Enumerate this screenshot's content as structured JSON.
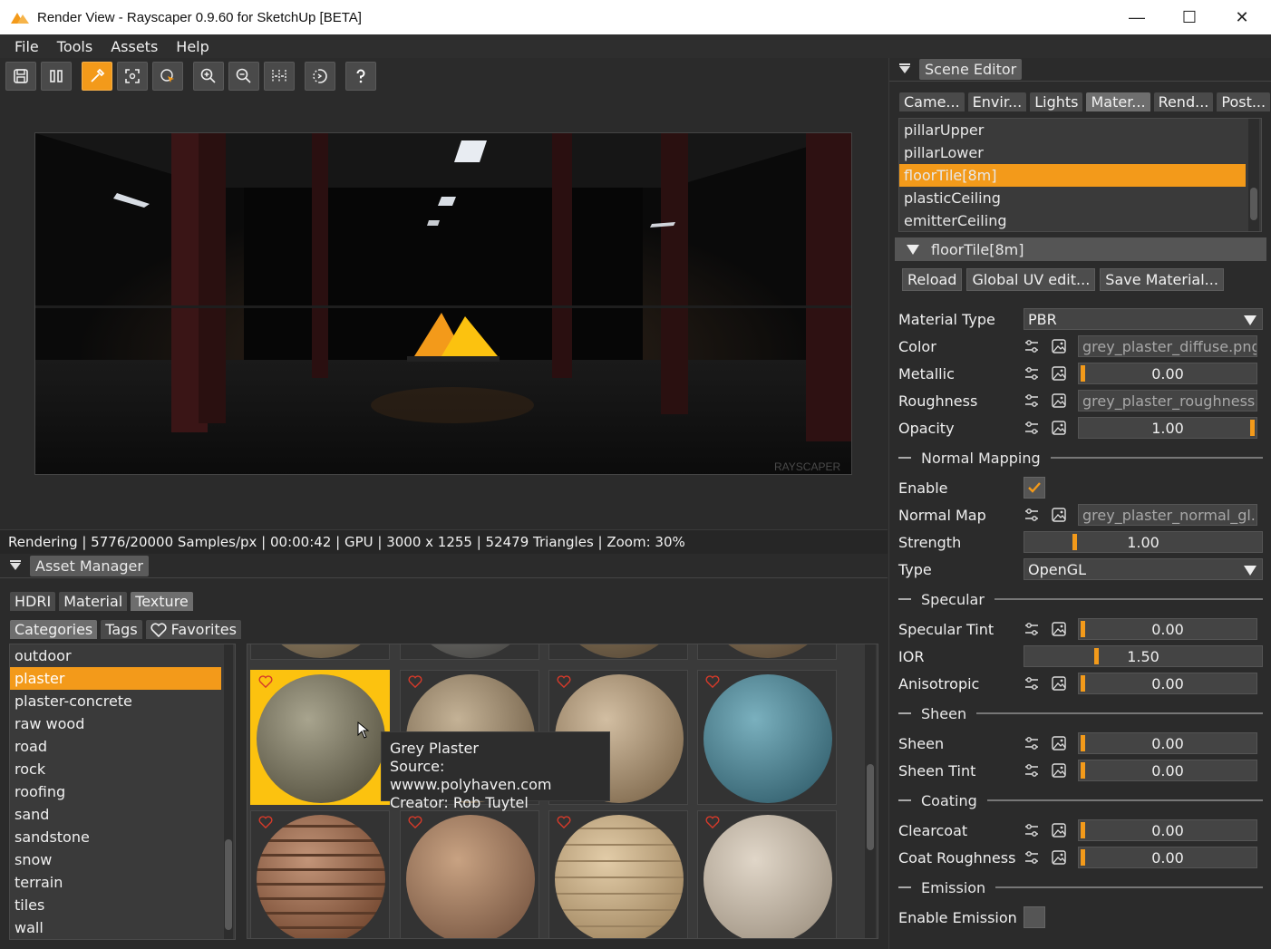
{
  "window": {
    "title": "Render View - Rayscaper 0.9.60 for SketchUp [BETA]",
    "minimize": "—",
    "maximize": "☐",
    "close": "✕"
  },
  "menu": [
    "File",
    "Tools",
    "Assets",
    "Help"
  ],
  "status": "Rendering | 5776/20000 Samples/px | 00:00:42 | GPU | 3000 x 1255 | 52479 Triangles | Zoom: 30%",
  "render": {
    "watermark": "RAYSCAPER"
  },
  "asset_manager": {
    "title": "Asset Manager",
    "tabs": [
      "HDRI",
      "Material",
      "Texture"
    ],
    "subtabs": {
      "categories": "Categories",
      "tags": "Tags",
      "favorites": "Favorites"
    },
    "categories": [
      "outdoor",
      "plaster",
      "plaster-concrete",
      "raw wood",
      "road",
      "rock",
      "roofing",
      "sand",
      "sandstone",
      "snow",
      "terrain",
      "tiles",
      "wall"
    ],
    "tooltip": {
      "name": "Grey Plaster",
      "source": "Source: wwww.polyhaven.com",
      "creator": "Creator: Rob Tuytel"
    }
  },
  "scene_editor": {
    "title": "Scene Editor",
    "tabs": [
      "Came...",
      "Envir...",
      "Lights",
      "Mater...",
      "Rend...",
      "Post..."
    ],
    "materials": [
      "pillarUpper",
      "pillarLower",
      "floorTile[8m]",
      "plasticCeiling",
      "emitterCeiling"
    ],
    "selected_header": "floorTile[8m]",
    "buttons": {
      "reload": "Reload",
      "uv": "Global UV edit...",
      "save": "Save Material..."
    },
    "props": {
      "material_type": {
        "label": "Material Type",
        "value": "PBR"
      },
      "color": {
        "label": "Color",
        "value": "grey_plaster_diffuse.png"
      },
      "metallic": {
        "label": "Metallic",
        "value": "0.00"
      },
      "roughness": {
        "label": "Roughness",
        "value": "grey_plaster_roughness.png"
      },
      "opacity": {
        "label": "Opacity",
        "value": "1.00"
      },
      "normal_section": "Normal Mapping",
      "enable": {
        "label": "Enable"
      },
      "normal_map": {
        "label": "Normal Map",
        "value": "grey_plaster_normal_gl.png"
      },
      "strength": {
        "label": "Strength",
        "value": "1.00"
      },
      "type": {
        "label": "Type",
        "value": "OpenGL"
      },
      "specular_section": "Specular",
      "specular_tint": {
        "label": "Specular Tint",
        "value": "0.00"
      },
      "ior": {
        "label": "IOR",
        "value": "1.50"
      },
      "anisotropic": {
        "label": "Anisotropic",
        "value": "0.00"
      },
      "sheen_section": "Sheen",
      "sheen": {
        "label": "Sheen",
        "value": "0.00"
      },
      "sheen_tint": {
        "label": "Sheen Tint",
        "value": "0.00"
      },
      "coating_section": "Coating",
      "clearcoat": {
        "label": "Clearcoat",
        "value": "0.00"
      },
      "coat_roughness": {
        "label": "Coat Roughness",
        "value": "0.00"
      },
      "emission_section": "Emission",
      "enable_emission": {
        "label": "Enable Emission"
      }
    }
  },
  "colors": {
    "accent": "#f39a1a",
    "selected_tile": "#fcc20f"
  }
}
